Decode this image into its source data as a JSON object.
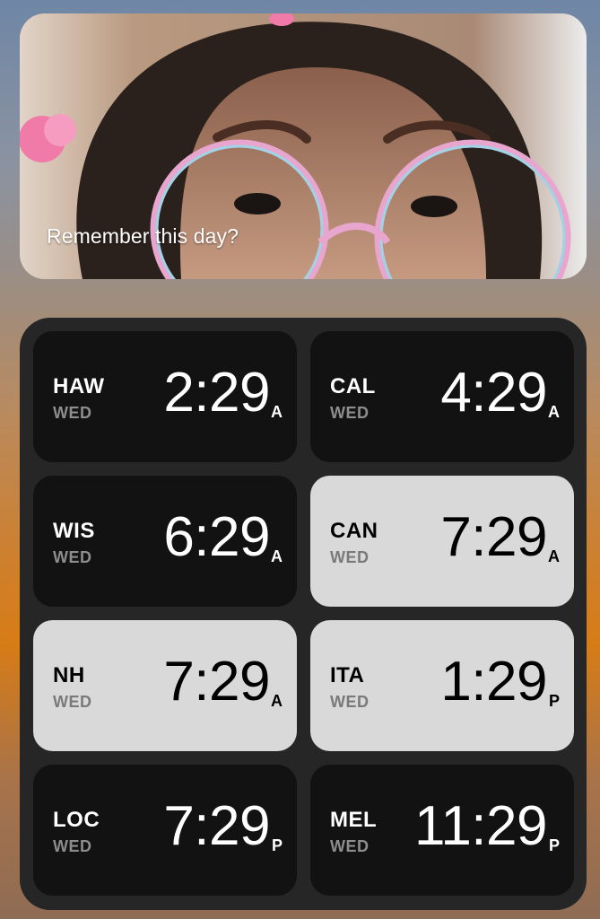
{
  "photo": {
    "caption": "Remember this day?"
  },
  "world_clock": {
    "tiles": [
      {
        "city": "HAW",
        "day": "WED",
        "time": "2:29",
        "ampm": "A",
        "theme": "dark"
      },
      {
        "city": "CAL",
        "day": "WED",
        "time": "4:29",
        "ampm": "A",
        "theme": "dark"
      },
      {
        "city": "WIS",
        "day": "WED",
        "time": "6:29",
        "ampm": "A",
        "theme": "dark"
      },
      {
        "city": "CAN",
        "day": "WED",
        "time": "7:29",
        "ampm": "A",
        "theme": "light"
      },
      {
        "city": "NH",
        "day": "WED",
        "time": "7:29",
        "ampm": "A",
        "theme": "light"
      },
      {
        "city": "ITA",
        "day": "WED",
        "time": "1:29",
        "ampm": "P",
        "theme": "light"
      },
      {
        "city": "LOC",
        "day": "WED",
        "time": "7:29",
        "ampm": "P",
        "theme": "dark"
      },
      {
        "city": "MEL",
        "day": "WED",
        "time": "11:29",
        "ampm": "P",
        "theme": "dark"
      }
    ]
  },
  "colors": {
    "dark_tile": "#121212",
    "light_tile": "#d9d9d9",
    "widget_bg": "#262626"
  }
}
